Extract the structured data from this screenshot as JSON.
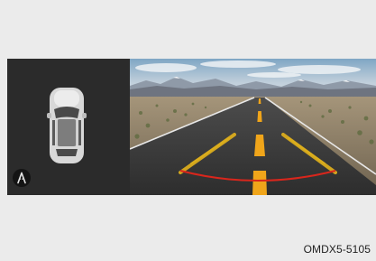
{
  "figure": {
    "code": "OMDX5-5105"
  },
  "display": {
    "side_panel": {
      "vehicle_icon": "car-top-view-icon",
      "mode_button_icon": "parking-camera-icon"
    },
    "camera_view": {
      "guide_colors": {
        "distance_arc": "#d9261c",
        "trajectory_lines": "#e2b21c",
        "center_line": "#f0a51a"
      }
    }
  }
}
